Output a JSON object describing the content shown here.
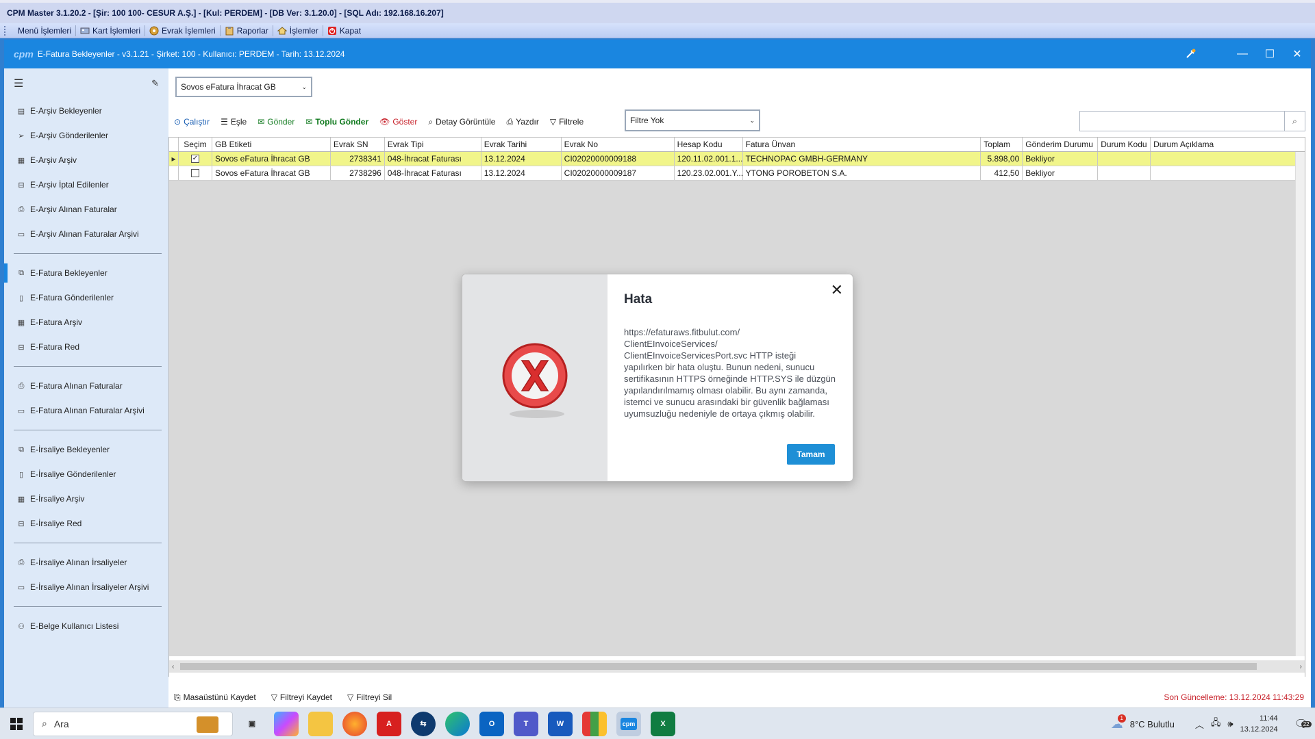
{
  "outer": {
    "title": "CPM Master 3.1.20.2 - [Şir: 100 100- CESUR A.Ş.] - [Kul: PERDEM] - [DB Ver: 3.1.20.0] - [SQL Adı: 192.168.16.207]",
    "menu": [
      {
        "label": "Menü İşlemleri",
        "icon": "menu-grip-icon"
      },
      {
        "label": "Kart İşlemleri",
        "icon": "cards-icon"
      },
      {
        "label": "Evrak İşlemleri",
        "icon": "documents-icon"
      },
      {
        "label": "Raporlar",
        "icon": "clipboard-icon"
      },
      {
        "label": "İşlemler",
        "icon": "home-icon"
      },
      {
        "label": "Kapat",
        "icon": "power-icon"
      }
    ]
  },
  "app": {
    "logo": "cpm",
    "title": "E-Fatura Bekleyenler - v3.1.21 - Şirket: 100 - Kullanıcı: PERDEM - Tarih: 13.12.2024"
  },
  "sidebar": {
    "groups": [
      [
        {
          "label": "E-Arşiv Bekleyenler",
          "icon": "list-doc-icon"
        },
        {
          "label": "E-Arşiv Gönderilenler",
          "icon": "send-icon"
        },
        {
          "label": "E-Arşiv Arşiv",
          "icon": "archive-icon"
        },
        {
          "label": "E-Arşiv İptal Edilenler",
          "icon": "cancel-doc-icon"
        },
        {
          "label": "E-Arşiv Alınan Faturalar",
          "icon": "inbox-icon"
        },
        {
          "label": "E-Arşiv Alınan Faturalar Arşivi",
          "icon": "folder-icon"
        }
      ],
      [
        {
          "label": "E-Fatura Bekleyenler",
          "icon": "doc-copy-icon",
          "active": true
        },
        {
          "label": "E-Fatura Gönderilenler",
          "icon": "doc-icon"
        },
        {
          "label": "E-Fatura Arşiv",
          "icon": "archive-icon"
        },
        {
          "label": "E-Fatura Red",
          "icon": "reject-icon"
        }
      ],
      [
        {
          "label": "E-Fatura Alınan Faturalar",
          "icon": "inbox-icon"
        },
        {
          "label": "E-Fatura Alınan Faturalar Arşivi",
          "icon": "folder-icon"
        }
      ],
      [
        {
          "label": "E-İrsaliye Bekleyenler",
          "icon": "doc-copy-icon"
        },
        {
          "label": "E-İrsaliye Gönderilenler",
          "icon": "doc-icon"
        },
        {
          "label": "E-İrsaliye Arşiv",
          "icon": "archive-icon"
        },
        {
          "label": "E-İrsaliye Red",
          "icon": "reject-icon"
        }
      ],
      [
        {
          "label": "E-İrsaliye Alınan İrsaliyeler",
          "icon": "inbox-icon"
        },
        {
          "label": "E-İrsaliye Alınan İrsaliyeler Arşivi",
          "icon": "folder-icon"
        }
      ],
      [
        {
          "label": "E-Belge Kullanıcı Listesi",
          "icon": "users-icon"
        }
      ]
    ]
  },
  "main": {
    "gb_select": "Sovos eFatura İhracat GB",
    "toolbar": {
      "run": "Çalıştır",
      "match": "Eşle",
      "send": "Gönder",
      "bulk_send": "Toplu Gönder",
      "show": "Göster",
      "detail": "Detay Görüntüle",
      "print": "Yazdır",
      "filter": "Filtrele"
    },
    "filter_select": "Filtre Yok",
    "search_placeholder": "",
    "columns": [
      "Seçim",
      "GB Etiketi",
      "Evrak SN",
      "Evrak Tipi",
      "Evrak Tarihi",
      "Evrak No",
      "Hesap Kodu",
      "Fatura Ünvan",
      "Toplam",
      "Gönderim Durumu",
      "Durum Kodu",
      "Durum Açıklama"
    ],
    "rows": [
      {
        "checked": true,
        "gb": "Sovos eFatura İhracat GB",
        "sn": "2738341",
        "tip": "048-İhracat Faturası",
        "tarih": "13.12.2024",
        "no": "CI02020000009188",
        "hesap": "120.11.02.001.1...",
        "unvan": "TECHNOPAC GMBH-GERMANY",
        "toplam": "5.898,00",
        "durum": "Bekliyor",
        "kod": "",
        "aciklama": ""
      },
      {
        "checked": false,
        "gb": "Sovos eFatura İhracat GB",
        "sn": "2738296",
        "tip": "048-İhracat Faturası",
        "tarih": "13.12.2024",
        "no": "CI02020000009187",
        "hesap": "120.23.02.001.Y...",
        "unvan": "YTONG POROBETON S.A.",
        "toplam": "412,50",
        "durum": "Bekliyor",
        "kod": "",
        "aciklama": ""
      }
    ],
    "status": {
      "save_desktop": "Masaüstünü Kaydet",
      "save_filter": "Filtreyi Kaydet",
      "delete_filter": "Filtreyi Sil",
      "last_update": "Son Güncelleme: 13.12.2024 11:43:29"
    }
  },
  "dialog": {
    "title": "Hata",
    "message": "https://efaturaws.fitbulut.com/\nClientEInvoiceServices/\nClientEInvoiceServicesPort.svc HTTP isteği yapılırken bir hata oluştu. Bunun nedeni, sunucu sertifikasının HTTPS örneğinde HTTP.SYS ile düzgün yapılandırılmamış olması olabilir. Bu aynı zamanda, istemci ve sunucu arasındaki bir güvenlik bağlaması uyumsuzluğu nedeniyle de ortaya çıkmış olabilir.",
    "ok": "Tamam"
  },
  "taskbar": {
    "search": "Ara",
    "weather": "8°C  Bulutlu",
    "weather_badge": "1",
    "time": "11:44",
    "date": "13.12.2024",
    "notif_count": "22"
  },
  "colors": {
    "accent": "#1a86e0",
    "selected_row": "#f1f58a",
    "error": "#c8232c",
    "ok_button": "#1e8fd6"
  }
}
